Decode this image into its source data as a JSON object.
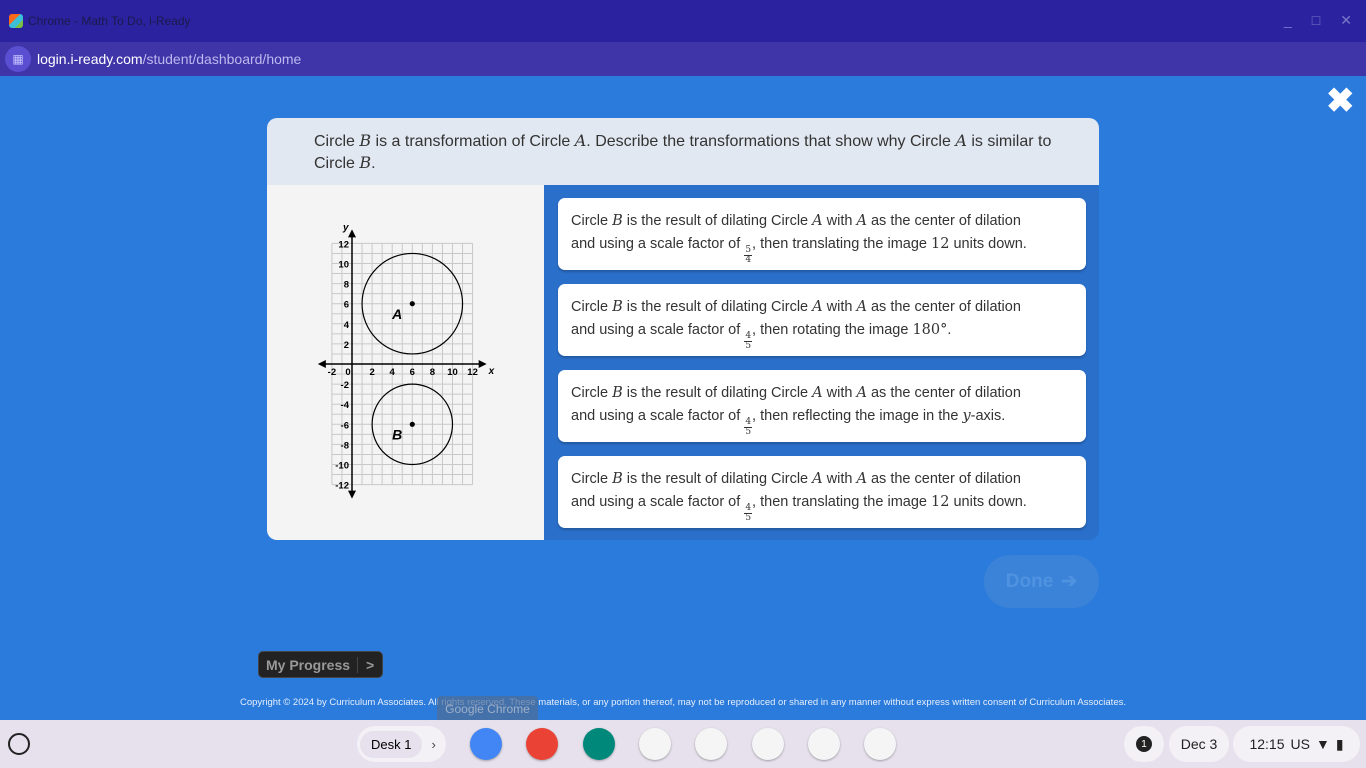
{
  "window": {
    "title": "Chrome - Math To Do, i-Ready",
    "url_host": "login.i-ready.com",
    "url_path": "/student/dashboard/home"
  },
  "question": {
    "p1": "Circle ",
    "v1": "B",
    "p2": " is a transformation of Circle ",
    "v2": "A",
    "p3": ". Describe the transformations that show why Circle ",
    "v3": "A",
    "p4": " is similar to Circle ",
    "v4": "B",
    "p5": "."
  },
  "graph": {
    "x_label": "x",
    "y_label": "y",
    "x_ticks": [
      "-2",
      "0",
      "2",
      "4",
      "6",
      "8",
      "10",
      "12"
    ],
    "y_ticks": [
      "12",
      "10",
      "8",
      "6",
      "4",
      "2",
      "-2",
      "-4",
      "-6",
      "-8",
      "-10",
      "-12"
    ],
    "xlim": [
      -2,
      12
    ],
    "ylim": [
      -12,
      12
    ],
    "circles": [
      {
        "label": "A",
        "cx": 6,
        "cy": 6,
        "r": 5
      },
      {
        "label": "B",
        "cx": 6,
        "cy": -6,
        "r": 4
      }
    ]
  },
  "options": [
    {
      "a": "Circle ",
      "b": "B",
      "c": " is the result of dilating Circle ",
      "d": "A",
      "e": " with ",
      "f": "A",
      "g": " as the center of dilation",
      "h": "and using a scale factor of ",
      "num": "5",
      "den": "4",
      "i": ", then translating the image ",
      "m": "12",
      "j": " units down."
    },
    {
      "a": "Circle ",
      "b": "B",
      "c": " is the result of dilating Circle ",
      "d": "A",
      "e": " with ",
      "f": "A",
      "g": " as the center of dilation",
      "h": "and using a scale factor of ",
      "num": "4",
      "den": "5",
      "i": ", then rotating the image ",
      "m": "180°",
      "j": "."
    },
    {
      "a": "Circle ",
      "b": "B",
      "c": " is the result of dilating Circle ",
      "d": "A",
      "e": " with ",
      "f": "A",
      "g": " as the center of dilation",
      "h": "and using a scale factor of ",
      "num": "4",
      "den": "5",
      "i": ", then reflecting the image in the ",
      "m": "y",
      "j": "-axis."
    },
    {
      "a": "Circle ",
      "b": "B",
      "c": " is the result of dilating Circle ",
      "d": "A",
      "e": " with ",
      "f": "A",
      "g": " as the center of dilation",
      "h": "and using a scale factor of ",
      "num": "4",
      "den": "5",
      "i": ", then translating the image ",
      "m": "12",
      "j": " units down."
    }
  ],
  "done_label": "Done",
  "progress": {
    "label": "My Progress",
    "arrow": ">"
  },
  "copyright": "Copyright © 2024 by Curriculum Associates. All rights reserved. These materials, or any portion thereof, may not be reproduced or shared in any manner without express written consent of Curriculum Associates.",
  "tooltip": "Google Chrome",
  "shelf": {
    "desk": "Desk 1",
    "notifications": "1",
    "date": "Dec 3",
    "time": "12:15",
    "locale": "US"
  },
  "apps": [
    {
      "name": "chrome",
      "color": "#4285f4"
    },
    {
      "name": "canvas",
      "color": "#ea4335"
    },
    {
      "name": "screencast",
      "color": "#00897b"
    },
    {
      "name": "classroom",
      "color": "#f5f5f5"
    },
    {
      "name": "gmail",
      "color": "#f5f5f5"
    },
    {
      "name": "docs",
      "color": "#f5f5f5"
    },
    {
      "name": "youtube",
      "color": "#f5f5f5"
    },
    {
      "name": "play-store",
      "color": "#f5f5f5"
    }
  ]
}
